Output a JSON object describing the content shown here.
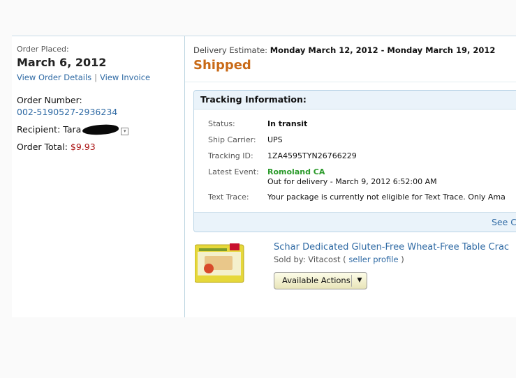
{
  "order": {
    "placed_label": "Order Placed:",
    "date": "March 6, 2012",
    "links": {
      "details": "View Order Details",
      "separator": "|",
      "invoice": "View Invoice"
    },
    "number_label": "Order Number:",
    "number": "002-5190527-2936234",
    "recipient_label": "Recipient: Tara",
    "total_label": "Order Total:",
    "total": "$9.93"
  },
  "shipment": {
    "estimate_label": "Delivery Estimate:",
    "estimate": "Monday March 12, 2012 - Monday March 19, 2012",
    "status": "Shipped",
    "status_color": "#c96a17"
  },
  "tracking": {
    "header": "Tracking Information:",
    "rows": [
      {
        "label": "Status:",
        "value": "In transit"
      },
      {
        "label": "Ship Carrier:",
        "value": "UPS"
      },
      {
        "label": "Tracking ID:",
        "value": "1ZA4595TYN26766229"
      },
      {
        "label": "Latest Event:",
        "value": "Romoland CA",
        "value2": "Out for delivery - March 9, 2012 6:52:00 AM"
      },
      {
        "label": "Text Trace:",
        "value": "Your package is currently not eligible for Text Trace. Only Ama"
      }
    ],
    "see_link": "See C"
  },
  "product": {
    "title": "Schar Dedicated Gluten-Free Wheat-Free Table Crac",
    "sold_by_label": "Sold by: Vitacost (",
    "seller_profile": "seller profile",
    "sold_by_close": ")",
    "actions_label": "Available Actions",
    "actions_icon": "chevron-down-icon"
  },
  "colors": {
    "link": "#2f6aa4",
    "event": "#2a9a2a",
    "price": "#aa1111"
  }
}
